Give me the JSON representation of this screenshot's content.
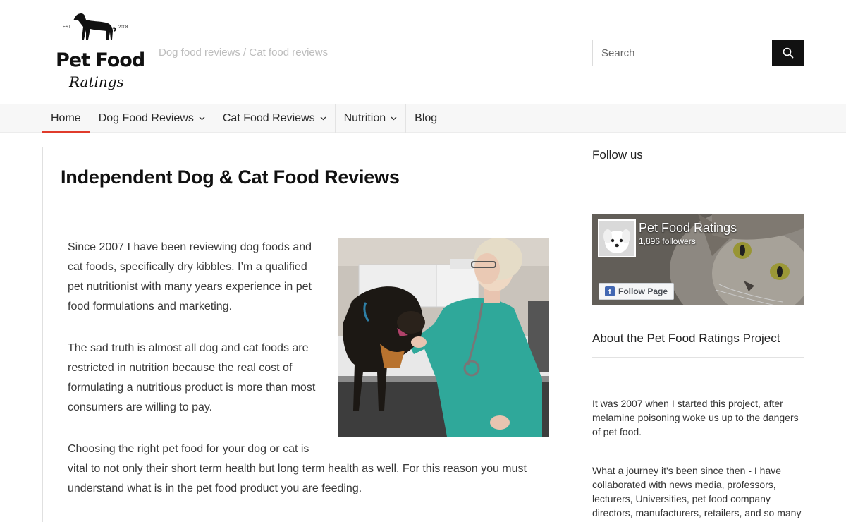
{
  "header": {
    "logo": {
      "est": "EST.",
      "year": "2008",
      "line1": "Pet Food",
      "line2": "Ratings"
    },
    "tagline": "Dog food reviews / Cat food reviews",
    "search": {
      "placeholder": "Search",
      "icon": "search-icon"
    }
  },
  "nav": {
    "items": [
      {
        "label": "Home",
        "active": true,
        "dropdown": false
      },
      {
        "label": "Dog Food Reviews",
        "active": false,
        "dropdown": true
      },
      {
        "label": "Cat Food Reviews",
        "active": false,
        "dropdown": true
      },
      {
        "label": "Nutrition",
        "active": false,
        "dropdown": true
      },
      {
        "label": "Blog",
        "active": false,
        "dropdown": false
      }
    ]
  },
  "main": {
    "title": "Independent Dog & Cat Food Reviews",
    "paragraphs": {
      "p1": "Since 2007 I have been reviewing dog foods and cat foods, specifically dry kibbles. I’m a qualified pet nutritionist with many years experience in pet food formulations and marketing.",
      "p2": "The sad truth is almost all dog and cat foods are restricted in nutrition because the real cost of formulating a nutritious product is more than most consumers are willing to pay.",
      "p3a": "Choosing the right pet food for your dog or cat is",
      "p3b": "vital to not only their short term health but long term health as well. For this reason you must understand what is in the pet food product you are feeding."
    }
  },
  "sidebar": {
    "follow_heading": "Follow us",
    "facebook": {
      "page_name": "Pet Food Ratings",
      "followers": "1,896 followers",
      "button_label": "Follow Page"
    },
    "about_heading": "About the Pet Food Ratings Project",
    "about_p1": "It was 2007 when I started this project, after melamine poisoning woke us up to the dangers of pet food.",
    "about_p2": "What a journey it's been since then - I have collaborated with news media, professors, lecturers, Universities, pet food company directors, manufacturers, retailers, and so many"
  },
  "colors": {
    "accent": "#e03b2b",
    "search_button": "#111111",
    "facebook": "#4267b2"
  }
}
